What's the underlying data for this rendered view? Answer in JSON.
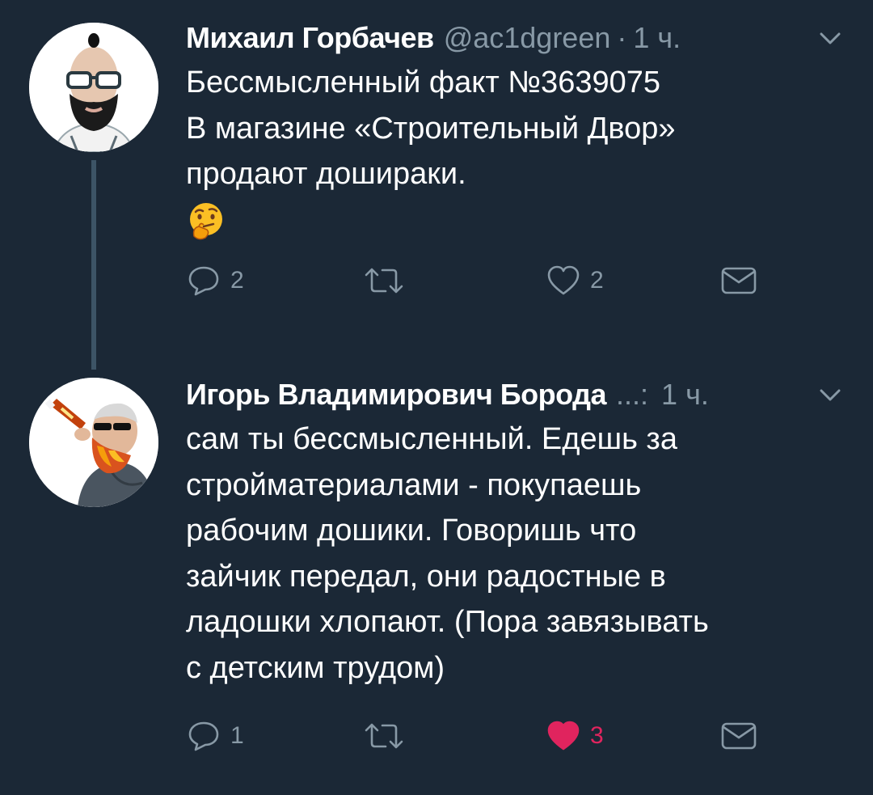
{
  "tweets": [
    {
      "author_name": "Михаил Горбачев",
      "handle": "@ac1dgreen",
      "separator": "·",
      "time": "1 ч.",
      "lines": [
        "Бессмысленный факт №3639075",
        "В магазине «Строительный Двор»",
        "продают дошираки."
      ],
      "emoji": "thinking-face",
      "actions": {
        "reply_count": "2",
        "retweet_count": "",
        "like_count": "2",
        "liked": false
      }
    },
    {
      "author_name": "Игорь Владимирович Борода",
      "handle": "...:",
      "separator": "",
      "time": "1 ч.",
      "lines": [
        "сам ты бессмысленный. Едешь за",
        "стройматериалами - покупаешь",
        "рабочим дошики. Говоришь что",
        "зайчик передал, они радостные в",
        "ладошки хлопают. (Пора завязывать",
        "с детским трудом)"
      ],
      "actions": {
        "reply_count": "1",
        "retweet_count": "",
        "like_count": "3",
        "liked": true
      }
    }
  ],
  "colors": {
    "background": "#1b2836",
    "text": "#ffffff",
    "secondary": "#8899a6",
    "like_active": "#e0245e",
    "thread_line": "#3d5466"
  },
  "icons": [
    "reply-icon",
    "retweet-icon",
    "like-icon",
    "direct-message-icon",
    "chevron-down-icon"
  ]
}
